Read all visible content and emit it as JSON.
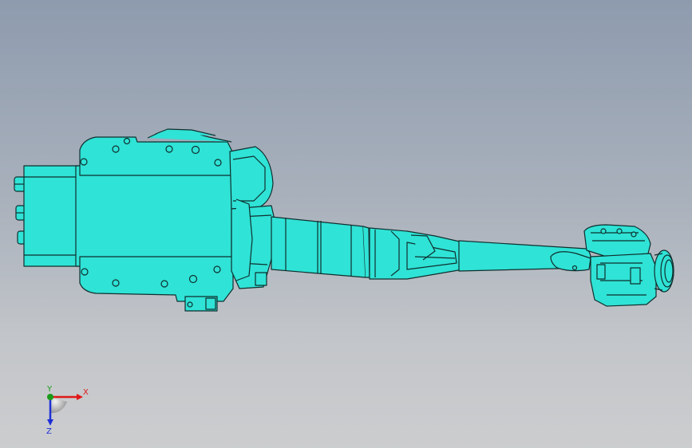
{
  "viewport": {
    "background_top": "#8e9bae",
    "background_bottom": "#cccdcf"
  },
  "model": {
    "fill_color": "#2fe3d6",
    "edge_color": "#0f2f2e",
    "shade_color": "#23c7bb"
  },
  "triad": {
    "x_label": "X",
    "y_label": "Y",
    "z_label": "Z",
    "x_color": "#e01818",
    "y_color": "#1a9b1a",
    "z_color": "#1e2fd6"
  }
}
